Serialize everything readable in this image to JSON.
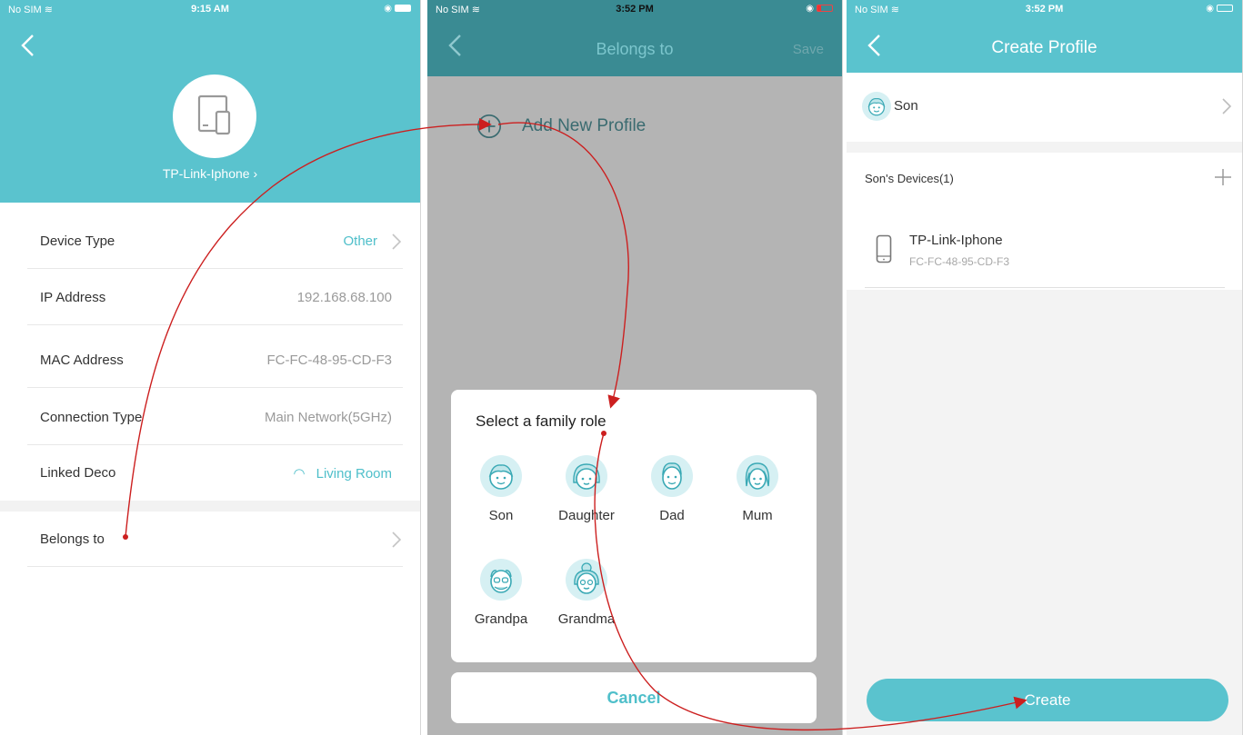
{
  "screen1": {
    "status": {
      "carrier": "No SIM",
      "time": "9:15 AM"
    },
    "device_name": "TP-Link-Iphone",
    "rows": [
      {
        "label": "Device Type",
        "value": "Other"
      },
      {
        "label": "IP Address",
        "value": "192.168.68.100"
      },
      {
        "label": "MAC Address",
        "value": "FC-FC-48-95-CD-F3"
      },
      {
        "label": "Connection Type",
        "value": "Main Network(5GHz)"
      },
      {
        "label": "Linked Deco",
        "value": "Living Room"
      },
      {
        "label": "Belongs to",
        "value": ""
      }
    ]
  },
  "screen2": {
    "status": {
      "carrier": "No SIM",
      "time": "3:52 PM"
    },
    "title": "Belongs to",
    "save_label": "Save",
    "add_profile_label": "Add New Profile",
    "sheet_title": "Select a family role",
    "roles": [
      "Son",
      "Daughter",
      "Dad",
      "Mum",
      "Grandpa",
      "Grandma"
    ],
    "cancel_label": "Cancel"
  },
  "screen3": {
    "status": {
      "carrier": "No SIM",
      "time": "3:52 PM"
    },
    "title": "Create Profile",
    "profile_name": "Son",
    "devices_header": "Son's Devices(1)",
    "device": {
      "name": "TP-Link-Iphone",
      "mac": "FC-FC-48-95-CD-F3"
    },
    "create_label": "Create"
  },
  "colors": {
    "accent": "#5ac3ce",
    "accent_dark": "#3a8b93",
    "flow_arrow": "#cc1f1f",
    "text_muted": "#9a9a9a"
  },
  "icons": [
    "chevron-left-icon",
    "wifi-icon",
    "battery-icon",
    "device-icon",
    "chevron-right-icon",
    "plus-circle-icon",
    "family-role-face-icon",
    "phone-icon",
    "plus-icon"
  ]
}
